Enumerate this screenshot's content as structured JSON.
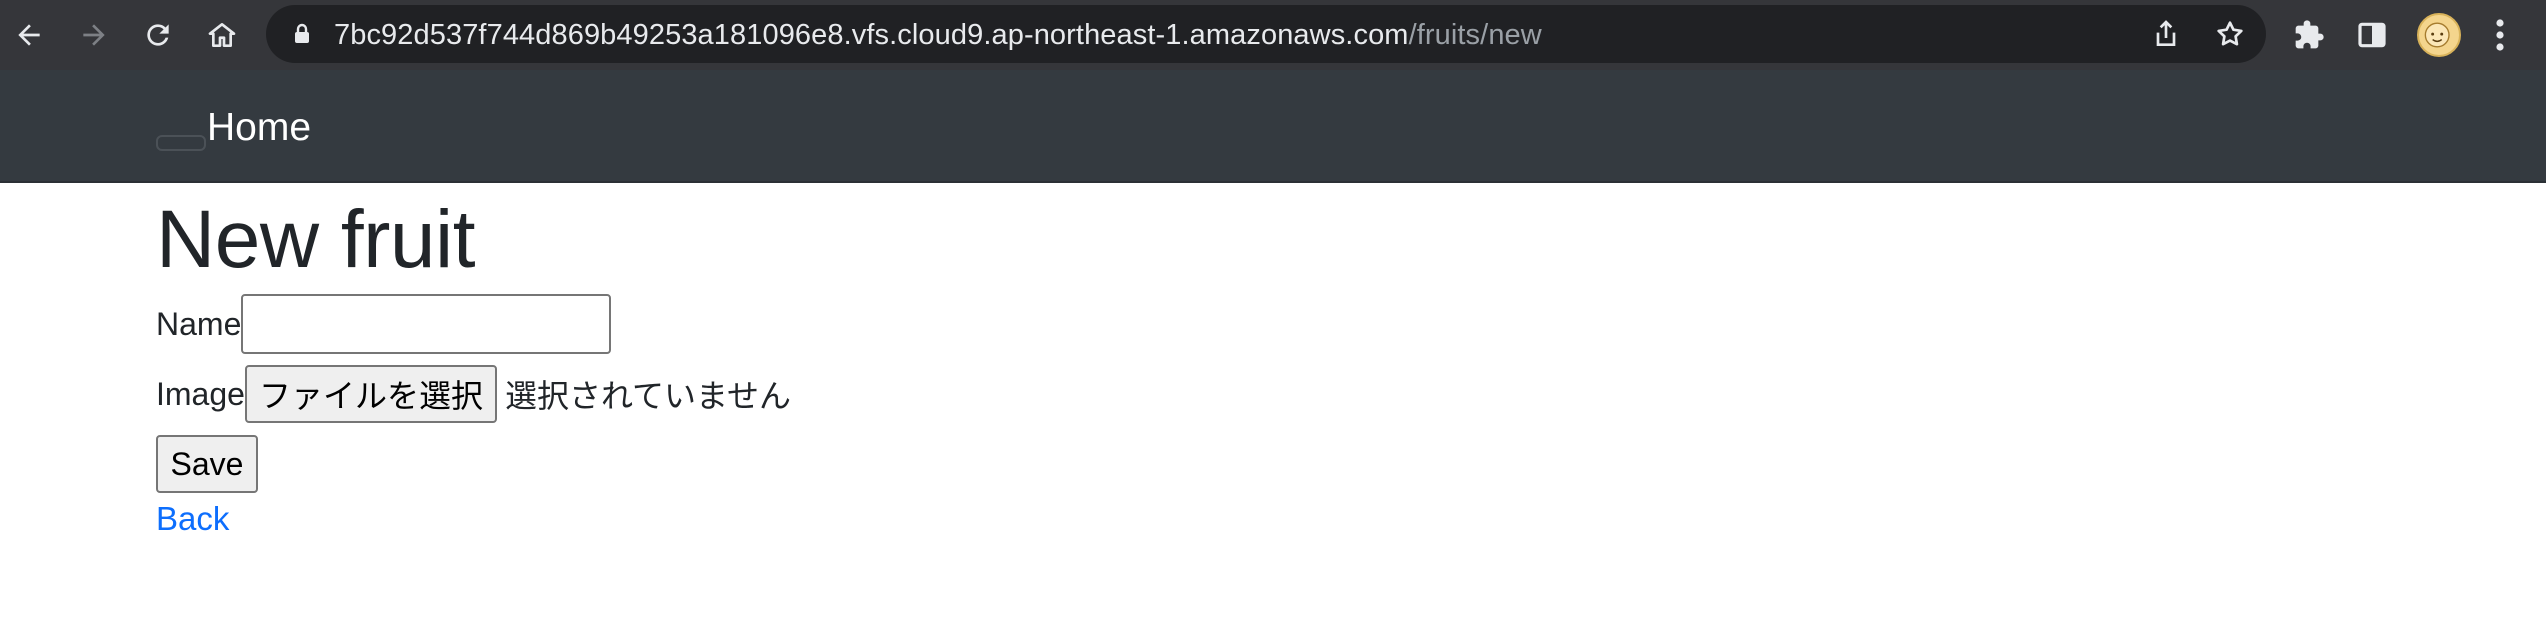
{
  "browser": {
    "url_host": "7bc92d537f744d869b49253a181096e8.vfs.cloud9.ap-northeast-1.amazonaws.com",
    "url_path": "/fruits/new",
    "icons": [
      "back-arrow-icon",
      "forward-arrow-icon",
      "reload-icon",
      "home-icon",
      "lock-icon",
      "share-icon",
      "star-icon",
      "extensions-icon",
      "side-panel-icon",
      "avatar",
      "more-menu-icon"
    ]
  },
  "navbar": {
    "brand": "Home"
  },
  "page": {
    "title": "New fruit",
    "name_label": "Name",
    "name_value": "",
    "image_label": "Image",
    "file_button": "ファイルを選択",
    "file_status": "選択されていません",
    "save_label": "Save",
    "back_label": "Back"
  },
  "colors": {
    "chrome_bg": "#35363a",
    "navbar_bg": "#343a40",
    "link": "#0d6efd"
  }
}
